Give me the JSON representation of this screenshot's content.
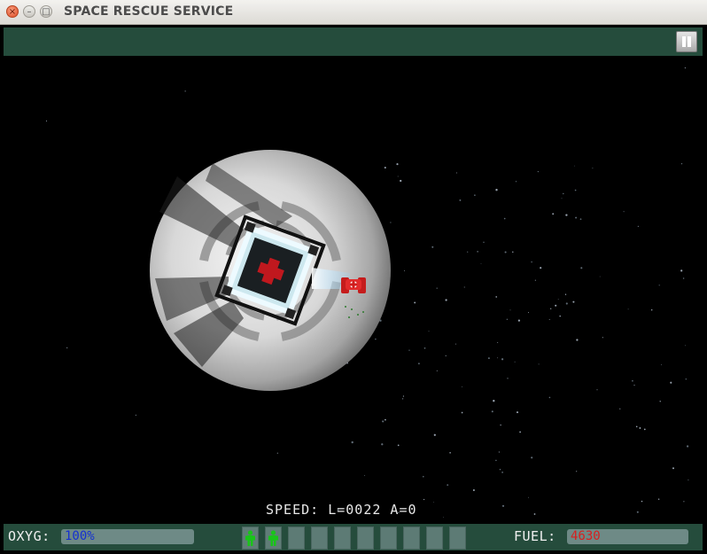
{
  "window": {
    "title": "SPACE RESCUE SERVICE"
  },
  "hud": {
    "speed_text": "SPEED: L=0022 A=0",
    "oxygen": {
      "label": "OXYG:",
      "value": "100%",
      "level": 1.0,
      "color": "#1530d0"
    },
    "fuel": {
      "label": "FUEL:",
      "value": "4630",
      "color": "#d81f1f"
    },
    "rescued_slots": {
      "total": 10,
      "filled": 2
    }
  },
  "colors": {
    "panel": "#254c3c",
    "slot": "#5d7b75",
    "astronaut": "#19c419",
    "ship": "#d01d1d"
  }
}
